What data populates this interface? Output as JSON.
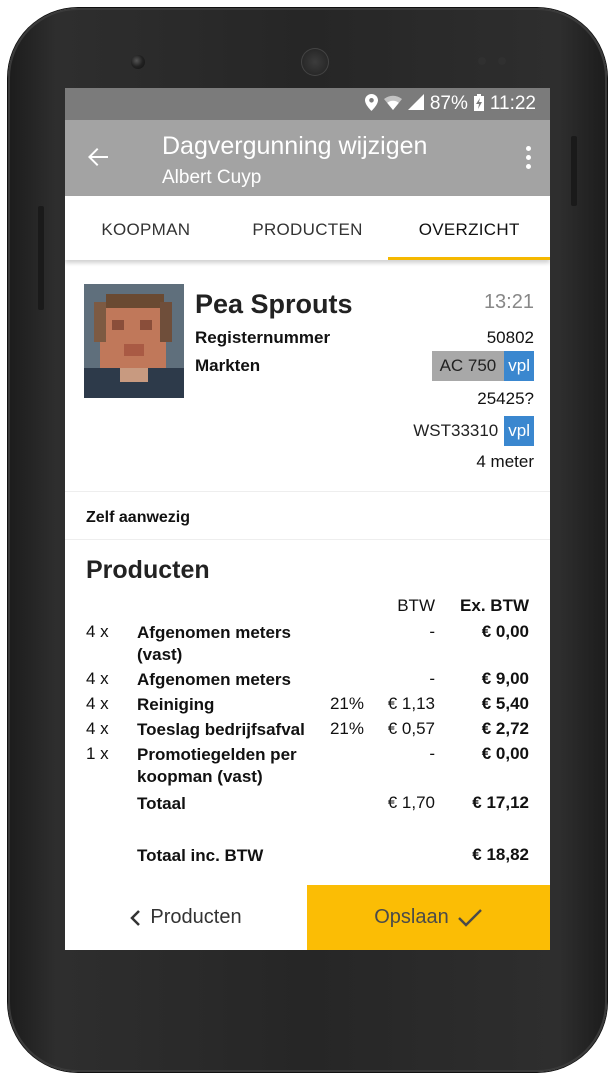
{
  "statusbar": {
    "location_icon": "location-icon",
    "wifi_icon": "wifi-icon",
    "signal_icon": "signal-icon",
    "battery_percent": "87%",
    "battery_icon": "battery-charging-icon",
    "time": "11:22"
  },
  "appbar": {
    "title": "Dagvergunning wijzigen",
    "subtitle": "Albert Cuyp",
    "back_icon": "arrow-left-icon",
    "menu_icon": "more-vertical-icon"
  },
  "tabs": [
    {
      "label": "KOOPMAN",
      "active": false
    },
    {
      "label": "PRODUCTEN",
      "active": false
    },
    {
      "label": "OVERZICHT",
      "active": true
    }
  ],
  "profile": {
    "name": "Pea Sprouts",
    "time": "13:21",
    "registernummer_label": "Registernummer",
    "registernummer_value": "50802",
    "markten_label": "Markten",
    "markt1_code": "AC 750",
    "markt1_tag": "vpl",
    "markt2_code": "25425?",
    "markt3_code": "WST33310",
    "markt3_tag": "vpl",
    "size": "4 meter"
  },
  "presence": {
    "label": "Zelf aanwezig"
  },
  "products": {
    "title": "Producten",
    "header_btw": "BTW",
    "header_ex_btw": "Ex. BTW",
    "rows": [
      {
        "qty": "4 x",
        "name": "Afgenomen meters (vast)",
        "pct": "",
        "btw": "-",
        "ex": "€ 0,00"
      },
      {
        "qty": "4 x",
        "name": "Afgenomen meters",
        "pct": "",
        "btw": "-",
        "ex": "€ 9,00"
      },
      {
        "qty": "4 x",
        "name": "Reiniging",
        "pct": "21%",
        "btw": "€ 1,13",
        "ex": "€ 5,40"
      },
      {
        "qty": "4 x",
        "name": "Toeslag bedrijfsafval",
        "pct": "21%",
        "btw": "€ 0,57",
        "ex": "€ 2,72"
      },
      {
        "qty": "1 x",
        "name": "Promotiegelden per koopman (vast)",
        "pct": "",
        "btw": "-",
        "ex": "€ 0,00"
      }
    ],
    "total_label": "Totaal",
    "total_btw": "€ 1,70",
    "total_ex": "€ 17,12",
    "total_inc_label": "Totaal inc. BTW",
    "total_inc": "€ 18,82"
  },
  "footer": {
    "back_label": "Producten",
    "back_icon": "chevron-left-icon",
    "save_label": "Opslaan",
    "save_icon": "check-icon",
    "save_color": "#fbbd05"
  }
}
